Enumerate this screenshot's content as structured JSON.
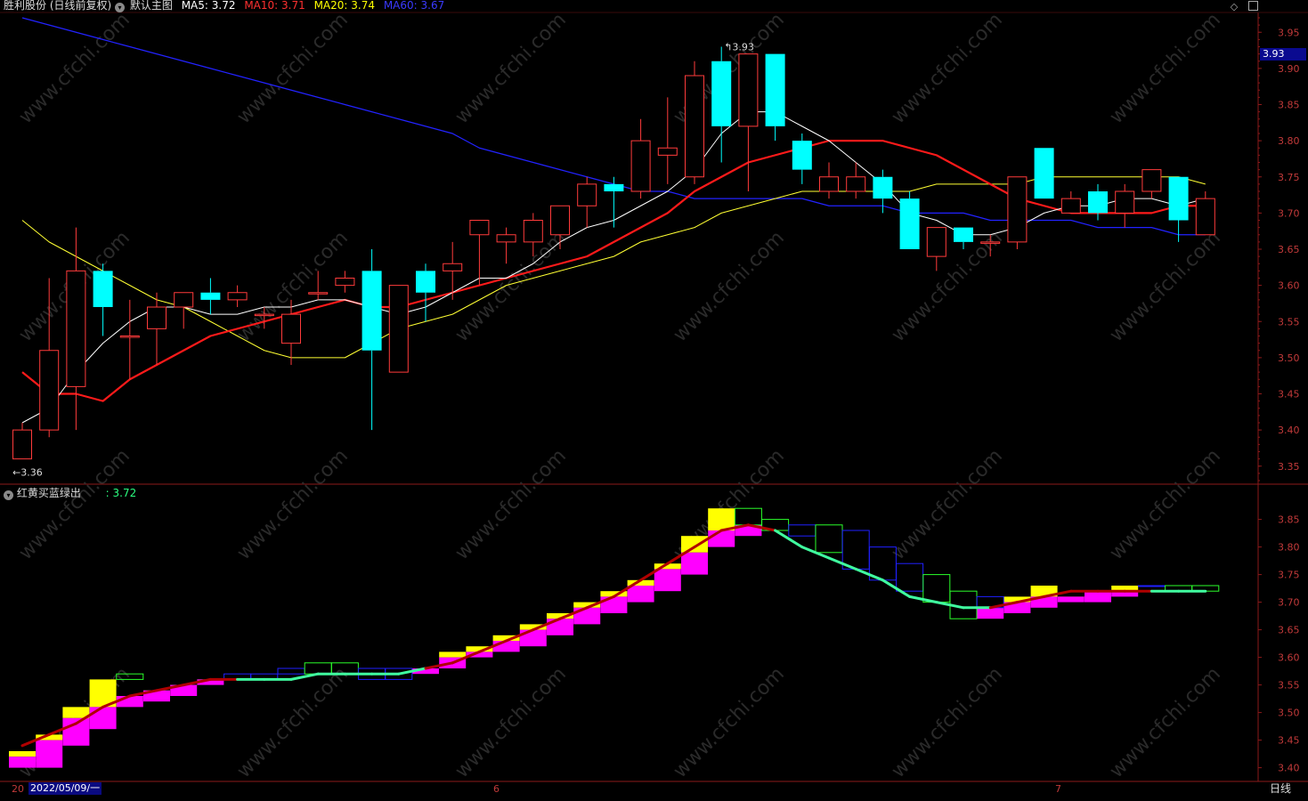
{
  "header": {
    "stock": "胜利股份 (日线前复权)",
    "template": "默认主图",
    "ma5": {
      "label": "MA5:",
      "value": "3.72",
      "color": "#ffffff"
    },
    "ma10": {
      "label": "MA10:",
      "value": "3.71",
      "color": "#ff3030"
    },
    "ma20": {
      "label": "MA20:",
      "value": "3.74",
      "color": "#ffff00"
    },
    "ma60": {
      "label": "MA60:",
      "value": "3.67",
      "color": "#3a3aff"
    }
  },
  "sub_header": {
    "title": "红黄买蓝绿出",
    "value": ": 3.72"
  },
  "annotations": {
    "high": "3.93",
    "low": "3.36",
    "current_price": "3.93"
  },
  "bottom_bar": {
    "left_code": "20",
    "date": "2022/05/09/一",
    "month_6": "6",
    "month_7": "7",
    "period": "日线"
  },
  "watermark": "www.cfchi.com",
  "colors": {
    "bg": "#000000",
    "up": "#ff3b3b",
    "down": "#00ffff",
    "grid": "#8b1a1a",
    "yellow": "#ffff00",
    "magenta": "#ff00ff",
    "darkred": "#b00000",
    "blue": "#2020ff",
    "green": "#2bff2b",
    "teal": "#40ffa0"
  },
  "chart_data": [
    {
      "type": "candlestick",
      "y_ticks": [
        "3.95",
        "3.90",
        "3.85",
        "3.80",
        "3.75",
        "3.70",
        "3.65",
        "3.60",
        "3.55",
        "3.50",
        "3.45",
        "3.40",
        "3.35"
      ],
      "ylim": [
        3.33,
        3.97
      ],
      "x_dates_marked": [
        "2022/05/09",
        "6",
        "7"
      ],
      "candles": [
        {
          "o": 3.36,
          "h": 3.41,
          "l": 3.36,
          "c": 3.4
        },
        {
          "o": 3.4,
          "h": 3.61,
          "l": 3.39,
          "c": 3.51
        },
        {
          "o": 3.46,
          "h": 3.68,
          "l": 3.4,
          "c": 3.62
        },
        {
          "o": 3.62,
          "h": 3.63,
          "l": 3.53,
          "c": 3.57
        },
        {
          "o": 3.53,
          "h": 3.58,
          "l": 3.47,
          "c": 3.53
        },
        {
          "o": 3.54,
          "h": 3.59,
          "l": 3.49,
          "c": 3.57
        },
        {
          "o": 3.57,
          "h": 3.59,
          "l": 3.54,
          "c": 3.59
        },
        {
          "o": 3.59,
          "h": 3.61,
          "l": 3.56,
          "c": 3.58
        },
        {
          "o": 3.58,
          "h": 3.6,
          "l": 3.57,
          "c": 3.59
        },
        {
          "o": 3.56,
          "h": 3.57,
          "l": 3.54,
          "c": 3.56
        },
        {
          "o": 3.52,
          "h": 3.58,
          "l": 3.49,
          "c": 3.56
        },
        {
          "o": 3.59,
          "h": 3.62,
          "l": 3.58,
          "c": 3.59
        },
        {
          "o": 3.6,
          "h": 3.62,
          "l": 3.59,
          "c": 3.61
        },
        {
          "o": 3.62,
          "h": 3.65,
          "l": 3.4,
          "c": 3.51
        },
        {
          "o": 3.48,
          "h": 3.6,
          "l": 3.48,
          "c": 3.6
        },
        {
          "o": 3.62,
          "h": 3.63,
          "l": 3.55,
          "c": 3.59
        },
        {
          "o": 3.62,
          "h": 3.66,
          "l": 3.58,
          "c": 3.63
        },
        {
          "o": 3.67,
          "h": 3.69,
          "l": 3.6,
          "c": 3.69
        },
        {
          "o": 3.66,
          "h": 3.68,
          "l": 3.63,
          "c": 3.67
        },
        {
          "o": 3.66,
          "h": 3.7,
          "l": 3.64,
          "c": 3.69
        },
        {
          "o": 3.67,
          "h": 3.71,
          "l": 3.65,
          "c": 3.71
        },
        {
          "o": 3.71,
          "h": 3.75,
          "l": 3.68,
          "c": 3.74
        },
        {
          "o": 3.74,
          "h": 3.75,
          "l": 3.68,
          "c": 3.73
        },
        {
          "o": 3.73,
          "h": 3.83,
          "l": 3.72,
          "c": 3.8
        },
        {
          "o": 3.78,
          "h": 3.86,
          "l": 3.74,
          "c": 3.79
        },
        {
          "o": 3.75,
          "h": 3.91,
          "l": 3.74,
          "c": 3.89
        },
        {
          "o": 3.91,
          "h": 3.93,
          "l": 3.77,
          "c": 3.82
        },
        {
          "o": 3.82,
          "h": 3.92,
          "l": 3.73,
          "c": 3.92
        },
        {
          "o": 3.92,
          "h": 3.92,
          "l": 3.8,
          "c": 3.82
        },
        {
          "o": 3.8,
          "h": 3.81,
          "l": 3.74,
          "c": 3.76
        },
        {
          "o": 3.73,
          "h": 3.77,
          "l": 3.72,
          "c": 3.75
        },
        {
          "o": 3.73,
          "h": 3.77,
          "l": 3.72,
          "c": 3.75
        },
        {
          "o": 3.75,
          "h": 3.76,
          "l": 3.7,
          "c": 3.72
        },
        {
          "o": 3.72,
          "h": 3.73,
          "l": 3.65,
          "c": 3.65
        },
        {
          "o": 3.64,
          "h": 3.68,
          "l": 3.62,
          "c": 3.68
        },
        {
          "o": 3.68,
          "h": 3.68,
          "l": 3.65,
          "c": 3.66
        },
        {
          "o": 3.66,
          "h": 3.67,
          "l": 3.64,
          "c": 3.66
        },
        {
          "o": 3.66,
          "h": 3.75,
          "l": 3.65,
          "c": 3.75
        },
        {
          "o": 3.79,
          "h": 3.79,
          "l": 3.72,
          "c": 3.72
        },
        {
          "o": 3.7,
          "h": 3.73,
          "l": 3.7,
          "c": 3.72
        },
        {
          "o": 3.73,
          "h": 3.74,
          "l": 3.69,
          "c": 3.7
        },
        {
          "o": 3.7,
          "h": 3.74,
          "l": 3.68,
          "c": 3.73
        },
        {
          "o": 3.73,
          "h": 3.76,
          "l": 3.72,
          "c": 3.76
        },
        {
          "o": 3.75,
          "h": 3.75,
          "l": 3.66,
          "c": 3.69
        },
        {
          "o": 3.67,
          "h": 3.73,
          "l": 3.67,
          "c": 3.72
        }
      ],
      "ma5": [
        3.41,
        3.43,
        3.48,
        3.52,
        3.55,
        3.57,
        3.57,
        3.56,
        3.56,
        3.57,
        3.57,
        3.58,
        3.58,
        3.57,
        3.56,
        3.57,
        3.59,
        3.61,
        3.61,
        3.63,
        3.66,
        3.68,
        3.69,
        3.71,
        3.73,
        3.76,
        3.81,
        3.84,
        3.84,
        3.82,
        3.8,
        3.77,
        3.74,
        3.7,
        3.69,
        3.67,
        3.67,
        3.68,
        3.7,
        3.71,
        3.71,
        3.72,
        3.72,
        3.71,
        3.72
      ],
      "ma10": [
        3.48,
        3.45,
        3.45,
        3.44,
        3.47,
        3.49,
        3.51,
        3.53,
        3.54,
        3.55,
        3.56,
        3.57,
        3.58,
        3.57,
        3.57,
        3.58,
        3.59,
        3.6,
        3.61,
        3.62,
        3.63,
        3.64,
        3.66,
        3.68,
        3.7,
        3.73,
        3.75,
        3.77,
        3.78,
        3.79,
        3.8,
        3.8,
        3.8,
        3.79,
        3.78,
        3.76,
        3.74,
        3.72,
        3.71,
        3.7,
        3.7,
        3.7,
        3.7,
        3.71,
        3.71
      ],
      "ma20": [
        3.69,
        3.66,
        3.64,
        3.62,
        3.6,
        3.58,
        3.57,
        3.55,
        3.53,
        3.51,
        3.5,
        3.5,
        3.5,
        3.52,
        3.54,
        3.55,
        3.56,
        3.58,
        3.6,
        3.61,
        3.62,
        3.63,
        3.64,
        3.66,
        3.67,
        3.68,
        3.7,
        3.71,
        3.72,
        3.73,
        3.73,
        3.73,
        3.73,
        3.73,
        3.74,
        3.74,
        3.74,
        3.74,
        3.75,
        3.75,
        3.75,
        3.75,
        3.75,
        3.75,
        3.74
      ],
      "ma60": [
        3.97,
        3.96,
        3.95,
        3.94,
        3.93,
        3.92,
        3.91,
        3.9,
        3.89,
        3.88,
        3.87,
        3.86,
        3.85,
        3.84,
        3.83,
        3.82,
        3.81,
        3.79,
        3.78,
        3.77,
        3.76,
        3.75,
        3.74,
        3.73,
        3.73,
        3.72,
        3.72,
        3.72,
        3.72,
        3.72,
        3.71,
        3.71,
        3.71,
        3.7,
        3.7,
        3.7,
        3.69,
        3.69,
        3.69,
        3.69,
        3.68,
        3.68,
        3.68,
        3.67,
        3.67
      ]
    },
    {
      "type": "step-area",
      "title": "红黄买蓝绿出",
      "y_ticks": [
        "3.85",
        "3.80",
        "3.75",
        "3.70",
        "3.65",
        "3.60",
        "3.55",
        "3.50",
        "3.45",
        "3.40"
      ],
      "ylim": [
        3.38,
        3.88
      ],
      "buy_segments": [
        {
          "i": 0,
          "low": 3.4,
          "mid": 3.42,
          "high": 3.43
        },
        {
          "i": 1,
          "low": 3.4,
          "mid": 3.45,
          "high": 3.46
        },
        {
          "i": 2,
          "low": 3.44,
          "mid": 3.49,
          "high": 3.51
        },
        {
          "i": 3,
          "low": 3.47,
          "mid": 3.51,
          "high": 3.56
        },
        {
          "i": 4,
          "low": 3.51,
          "mid": 3.53,
          "high": 3.53
        },
        {
          "i": 5,
          "low": 3.52,
          "mid": 3.54,
          "high": 3.54
        },
        {
          "i": 6,
          "low": 3.53,
          "mid": 3.55,
          "high": 3.55
        },
        {
          "i": 7,
          "low": 3.55,
          "mid": 3.56,
          "high": 3.56
        },
        {
          "i": 15,
          "low": 3.57,
          "mid": 3.58,
          "high": 3.58
        },
        {
          "i": 16,
          "low": 3.58,
          "mid": 3.6,
          "high": 3.61
        },
        {
          "i": 17,
          "low": 3.6,
          "mid": 3.61,
          "high": 3.62
        },
        {
          "i": 18,
          "low": 3.61,
          "mid": 3.63,
          "high": 3.64
        },
        {
          "i": 19,
          "low": 3.62,
          "mid": 3.65,
          "high": 3.66
        },
        {
          "i": 20,
          "low": 3.64,
          "mid": 3.67,
          "high": 3.68
        },
        {
          "i": 21,
          "low": 3.66,
          "mid": 3.69,
          "high": 3.7
        },
        {
          "i": 22,
          "low": 3.68,
          "mid": 3.71,
          "high": 3.72
        },
        {
          "i": 23,
          "low": 3.7,
          "mid": 3.73,
          "high": 3.74
        },
        {
          "i": 24,
          "low": 3.72,
          "mid": 3.76,
          "high": 3.77
        },
        {
          "i": 25,
          "low": 3.75,
          "mid": 3.79,
          "high": 3.82
        },
        {
          "i": 26,
          "low": 3.8,
          "mid": 3.83,
          "high": 3.87
        },
        {
          "i": 27,
          "low": 3.82,
          "mid": 3.84,
          "high": 3.84
        },
        {
          "i": 36,
          "low": 3.67,
          "mid": 3.69,
          "high": 3.69
        },
        {
          "i": 37,
          "low": 3.68,
          "mid": 3.7,
          "high": 3.71
        },
        {
          "i": 38,
          "low": 3.69,
          "mid": 3.71,
          "high": 3.73
        },
        {
          "i": 39,
          "low": 3.7,
          "mid": 3.71,
          "high": 3.71
        },
        {
          "i": 40,
          "low": 3.7,
          "mid": 3.72,
          "high": 3.72
        },
        {
          "i": 41,
          "low": 3.71,
          "mid": 3.72,
          "high": 3.73
        }
      ],
      "sell_segments": [
        {
          "i": 4,
          "low": 3.56,
          "high": 3.57,
          "c": "green"
        },
        {
          "i": 8,
          "low": 3.56,
          "high": 3.57,
          "c": "blue"
        },
        {
          "i": 9,
          "low": 3.56,
          "high": 3.57,
          "c": "blue"
        },
        {
          "i": 10,
          "low": 3.57,
          "high": 3.58,
          "c": "blue"
        },
        {
          "i": 11,
          "low": 3.57,
          "high": 3.59,
          "c": "green"
        },
        {
          "i": 12,
          "low": 3.57,
          "high": 3.59,
          "c": "green"
        },
        {
          "i": 13,
          "low": 3.56,
          "high": 3.58,
          "c": "blue"
        },
        {
          "i": 14,
          "low": 3.56,
          "high": 3.58,
          "c": "blue"
        },
        {
          "i": 27,
          "low": 3.84,
          "high": 3.87,
          "c": "green"
        },
        {
          "i": 28,
          "low": 3.83,
          "high": 3.85,
          "c": "green"
        },
        {
          "i": 29,
          "low": 3.82,
          "high": 3.84,
          "c": "blue"
        },
        {
          "i": 30,
          "low": 3.79,
          "high": 3.84,
          "c": "green"
        },
        {
          "i": 31,
          "low": 3.76,
          "high": 3.83,
          "c": "blue"
        },
        {
          "i": 32,
          "low": 3.74,
          "high": 3.8,
          "c": "blue"
        },
        {
          "i": 33,
          "low": 3.72,
          "high": 3.77,
          "c": "blue"
        },
        {
          "i": 34,
          "low": 3.7,
          "high": 3.75,
          "c": "green"
        },
        {
          "i": 35,
          "low": 3.67,
          "high": 3.72,
          "c": "green"
        },
        {
          "i": 36,
          "low": 3.69,
          "high": 3.71,
          "c": "blue"
        },
        {
          "i": 42,
          "low": 3.73,
          "high": 3.73,
          "c": "blue"
        },
        {
          "i": 43,
          "low": 3.72,
          "high": 3.73,
          "c": "green"
        },
        {
          "i": 44,
          "low": 3.72,
          "high": 3.73,
          "c": "green"
        }
      ],
      "trend_line": [
        3.44,
        3.46,
        3.48,
        3.51,
        3.53,
        3.54,
        3.55,
        3.56,
        3.56,
        3.56,
        3.56,
        3.57,
        3.57,
        3.57,
        3.57,
        3.58,
        3.59,
        3.61,
        3.63,
        3.65,
        3.67,
        3.69,
        3.71,
        3.74,
        3.77,
        3.8,
        3.83,
        3.84,
        3.83,
        3.8,
        3.78,
        3.76,
        3.74,
        3.71,
        3.7,
        3.69,
        3.69,
        3.7,
        3.71,
        3.72,
        3.72,
        3.72,
        3.72,
        3.72,
        3.72
      ]
    }
  ]
}
